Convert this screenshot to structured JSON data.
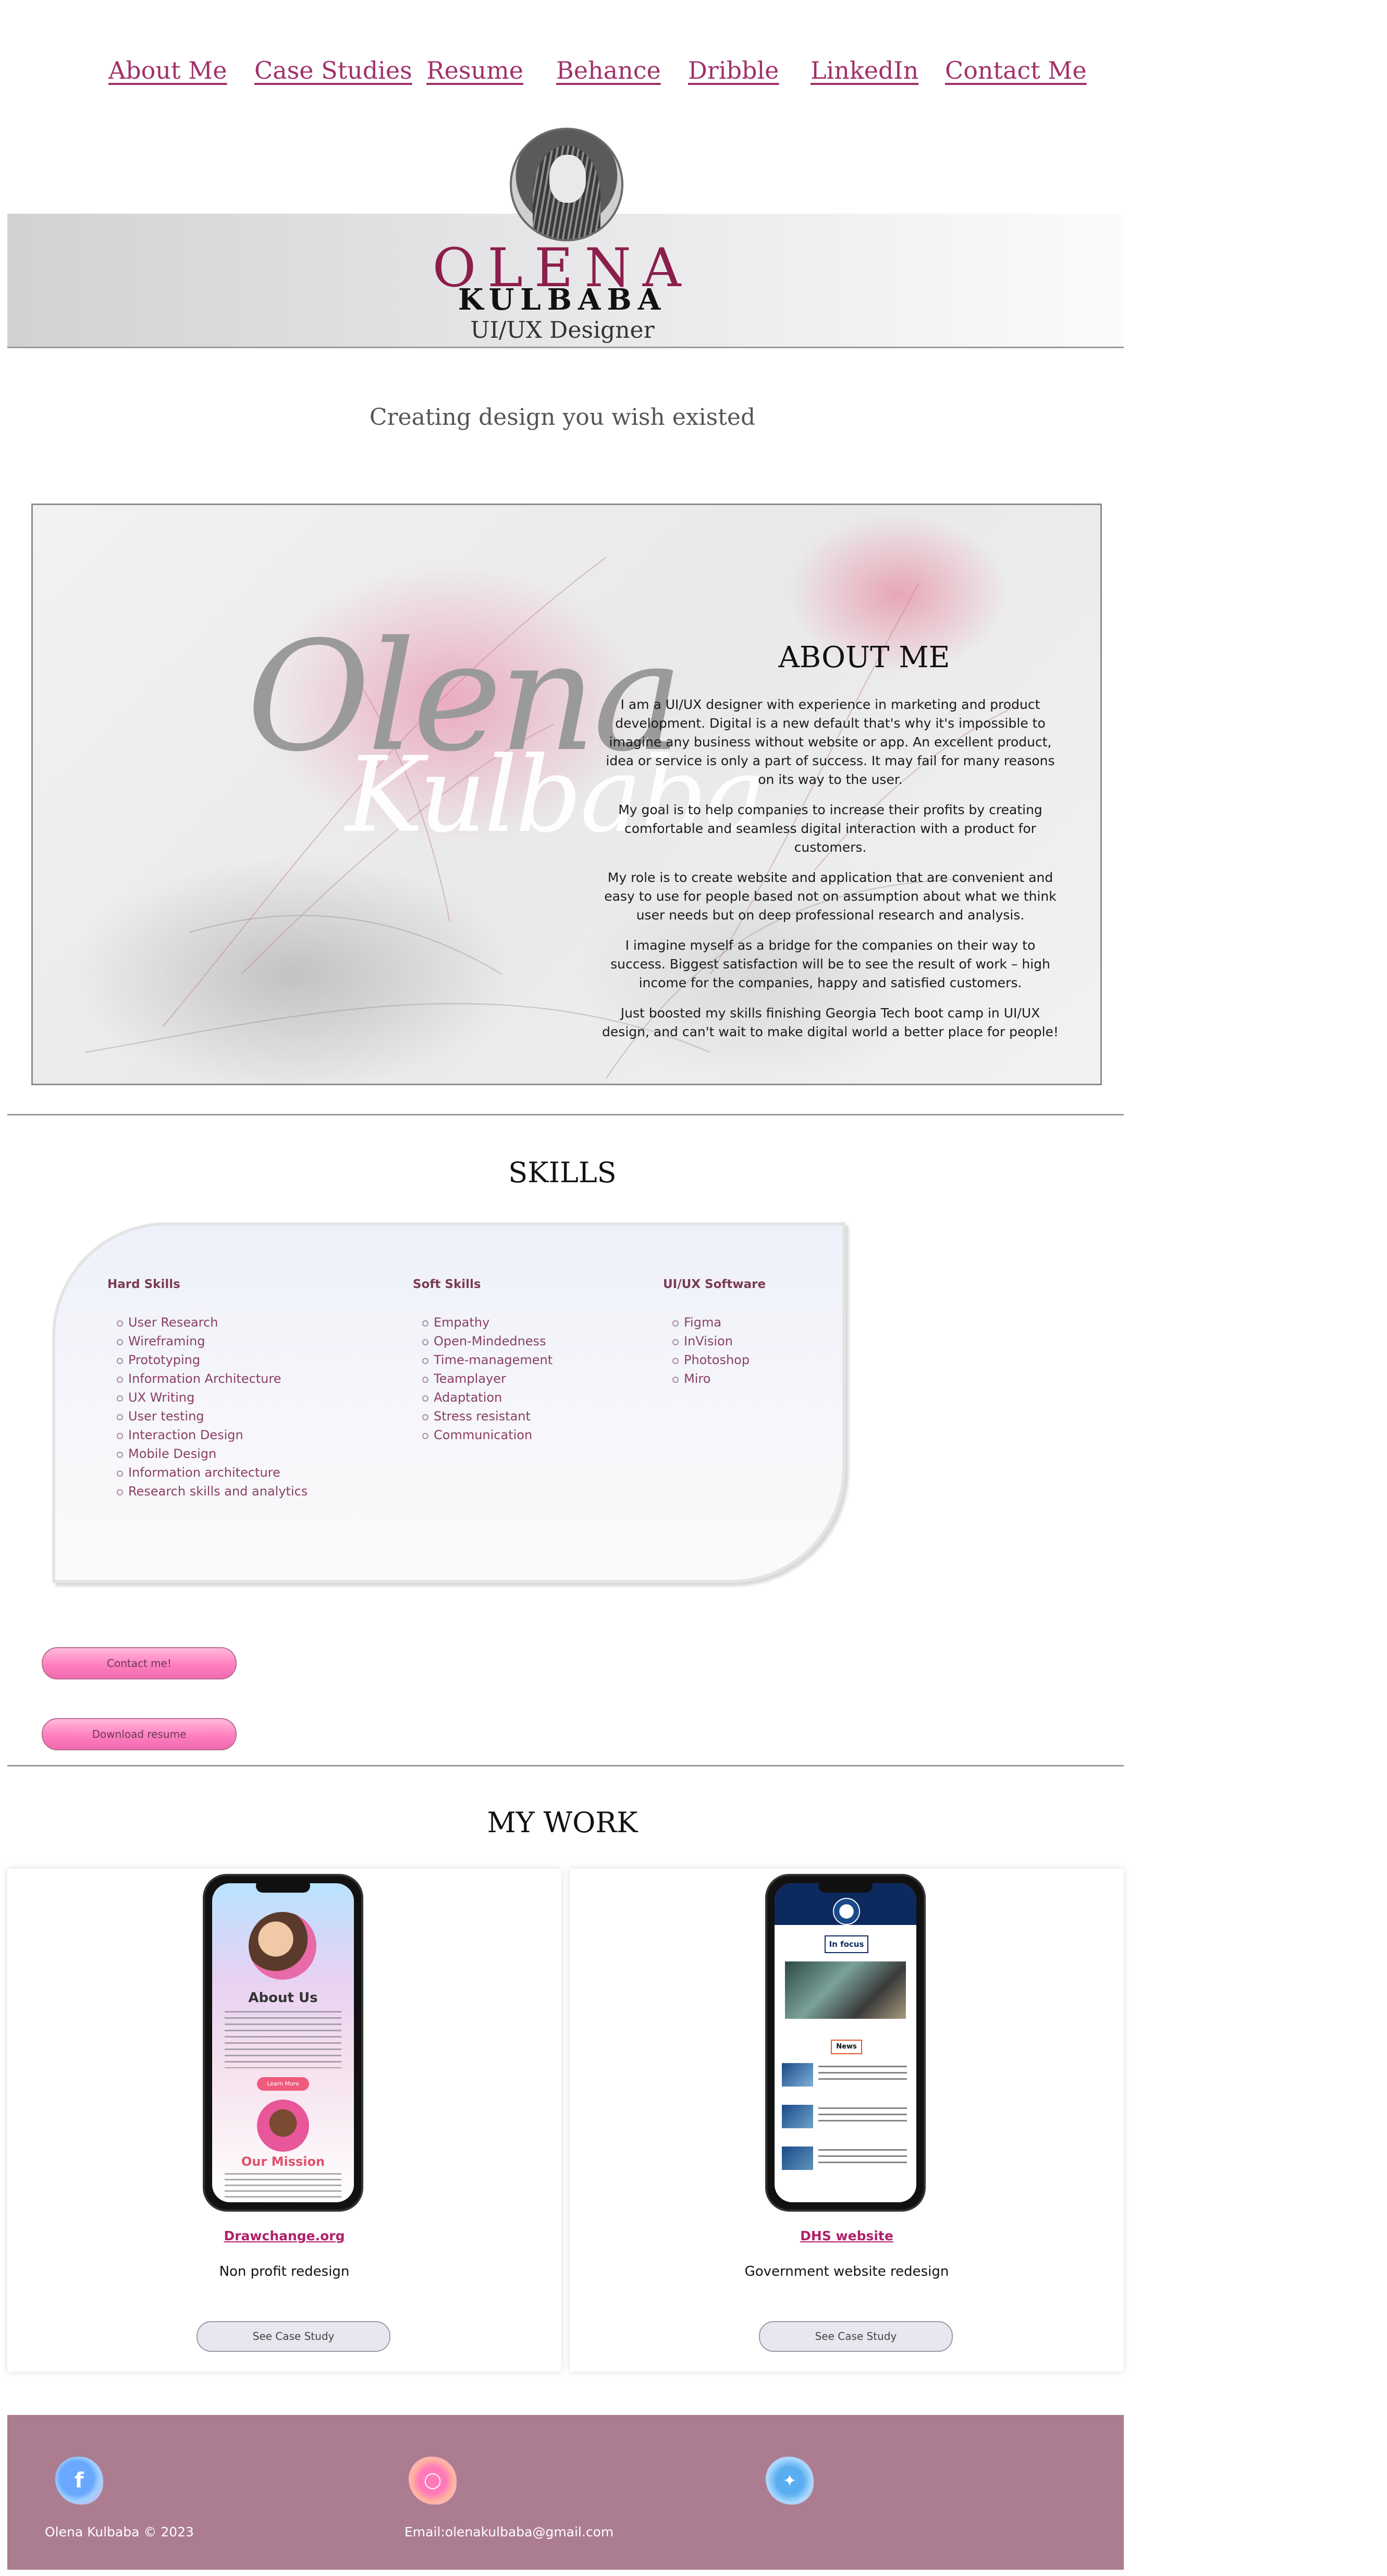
{
  "nav": {
    "items": [
      "About Me",
      "Case Studies",
      "Resume",
      "Behance",
      "Dribble",
      "LinkedIn",
      "Contact Me"
    ]
  },
  "hero": {
    "first_name": "OLENA",
    "last_name": "KULBABA",
    "role": "UI/UX Designer",
    "tagline": "Creating design you wish existed"
  },
  "about": {
    "script_line1": "Olena",
    "script_line2": "Kulbaba",
    "title": "ABOUT ME",
    "paragraphs": [
      "I am a UI/UX designer with experience in marketing and product development. Digital is a new default that's why it's impossible to imagine any business without website or app. An excellent product, idea or service is only a part of success. It may fail for many reasons on its way to the user.",
      "My goal is to help companies to increase their profits by creating comfortable and seamless digital interaction with a product for customers.",
      "My role is to create website and application that are convenient and easy to use for people based not on assumption about what we think user needs but on deep professional research and analysis.",
      "I imagine myself as a bridge for the companies on their way to success. Biggest satisfaction will be to see the result of work – high income for the companies, happy and satisfied customers.",
      "Just boosted my skills finishing Georgia Tech boot camp in UI/UX design, and can't wait to make digital world a better place for people!"
    ]
  },
  "skills": {
    "title": "SKILLS",
    "columns": [
      {
        "heading": "Hard Skills",
        "items": [
          "User Research",
          "Wireframing",
          "Prototyping",
          "Information Architecture",
          "UX Writing",
          "User testing",
          "Interaction Design",
          "Mobile Design",
          "Information architecture",
          "Research skills and analytics"
        ]
      },
      {
        "heading": "Soft Skills",
        "items": [
          "Empathy",
          "Open-Mindedness",
          "Time-management",
          "Teamplayer",
          "Adaptation",
          "Stress resistant",
          "Communication"
        ]
      },
      {
        "heading": "UI/UX Software",
        "items": [
          "Figma",
          "InVision",
          "Photoshop",
          "Miro"
        ]
      }
    ]
  },
  "buttons": {
    "contact": "Contact me!",
    "resume": "Download resume"
  },
  "work": {
    "title": "MY WORK",
    "projects": [
      {
        "link": "Drawchange.org",
        "desc": "Non profit redesign",
        "button": "See Case Study",
        "screen_title": "About Us",
        "screen_sub": "Our Mission",
        "screen_cta": "Learn More"
      },
      {
        "link": "DHS website",
        "desc": "Government website redesign",
        "button": "See Case Study",
        "screen_title": "In focus",
        "screen_sub": "News"
      }
    ]
  },
  "footer": {
    "copyright": "Olena Kulbaba © 2023",
    "email": "Email:olenakulbaba@gmail.com",
    "social": [
      "facebook-icon",
      "instagram-icon",
      "twitter-icon"
    ]
  },
  "colors": {
    "accent": "#a1306a",
    "footer_bg": "#ac7d91",
    "pill": "#ff7fbe"
  }
}
